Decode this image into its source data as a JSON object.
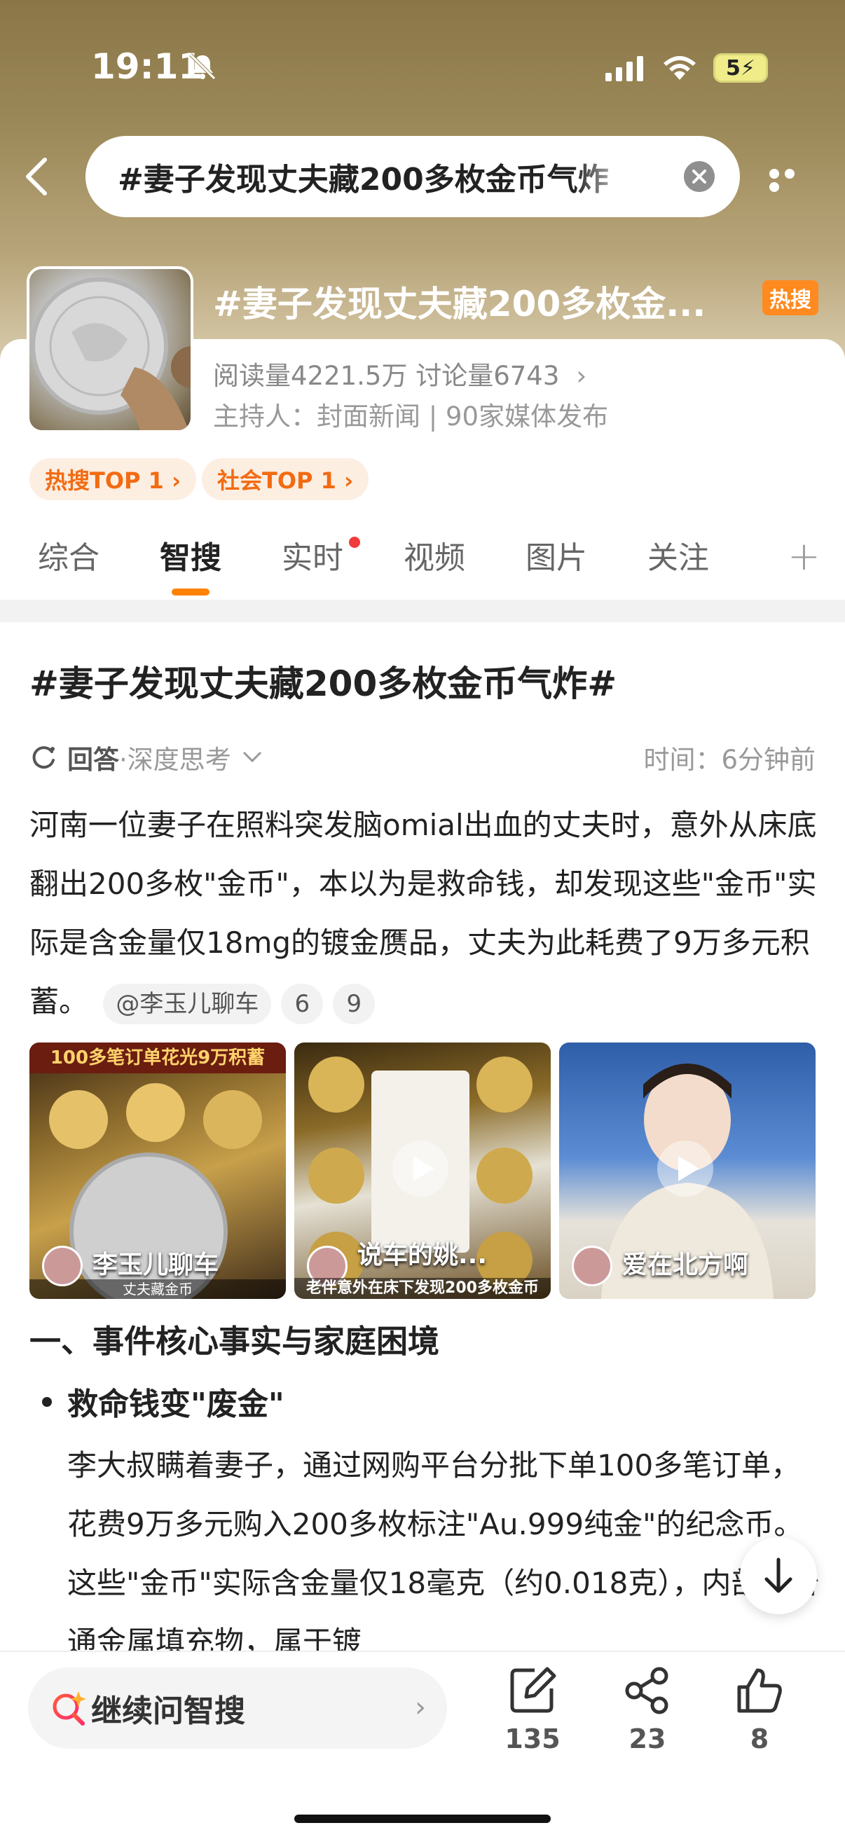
{
  "status_bar": {
    "time": "19:11",
    "battery": "5"
  },
  "search": {
    "query": "#妻子发现丈夫藏200多枚金币气炸"
  },
  "topic": {
    "title": "#妻子发现丈夫藏200多枚金...",
    "hot_badge": "热搜",
    "stats": "阅读量4221.5万  讨论量6743",
    "host": "主持人：封面新闻 | 90家媒体发布",
    "pills": [
      "热搜TOP 1 ›",
      "社会TOP 1 ›"
    ]
  },
  "tabs": [
    "综合",
    "智搜",
    "实时",
    "视频",
    "图片",
    "关注"
  ],
  "active_tab": "智搜",
  "answer": {
    "title": "#妻子发现丈夫藏200多枚金币气炸#",
    "meta_label": "回答",
    "meta_mode": "·深度思考",
    "time": "时间：6分钟前",
    "paragraph": "河南一位妻子在照料突发脑omial出血的丈夫时，意外从床底翻出200多枚\"金币\"，本以为是救命钱，却发现这些\"金币\"实际是含金量仅18mg的镀金赝品，丈夫为此耗费了9万多元积蓄。",
    "mention": "@李玉儿聊车",
    "ref1": "6",
    "ref2": "9"
  },
  "media": [
    {
      "label": "李玉儿聊车",
      "banner": "100多笔订单花光9万积蓄",
      "caption": "丈夫藏金币"
    },
    {
      "label": "说车的姚...",
      "caption": "老伴意外在床下发现200多枚金币"
    },
    {
      "label": "爱在北方啊"
    }
  ],
  "section": {
    "heading": "一、事件核心事实与家庭困境",
    "bullet_title": "救命钱变\"废金\"",
    "bullet_body": "李大叔瞒着妻子，通过网购平台分批下单100多笔订单，花费9万多元购入200多枚标注\"Au.999纯金\"的纪念币。这些\"金币\"实际含金量仅18毫克（约0.018克），内部为普通金属填充物，属于镀"
  },
  "bottom": {
    "ask_label": "继续问智搜",
    "comments": "135",
    "shares": "23",
    "likes": "8"
  },
  "colors": {
    "accent": "#ff8200",
    "hot": "#ff8a1f",
    "pill_text": "#f26b12"
  }
}
